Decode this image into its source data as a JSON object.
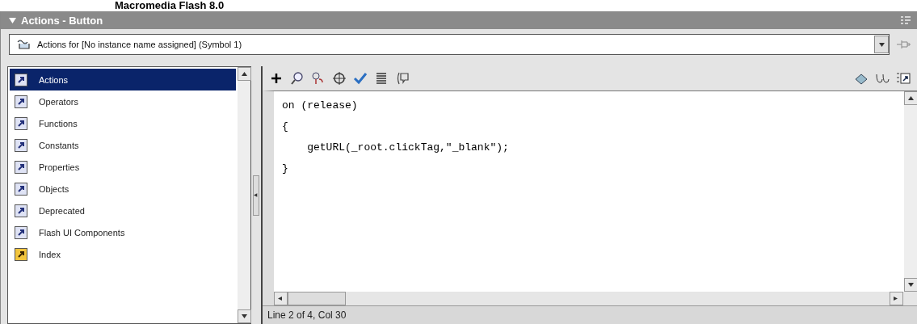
{
  "caption": "Macromedia Flash 8.0",
  "panel": {
    "title": "Actions - Button",
    "expanded": true
  },
  "target": {
    "value": "Actions for [No instance name assigned] (Symbol 1)"
  },
  "toolbox": {
    "items": [
      {
        "label": "Actions",
        "selected": true,
        "kind": "book"
      },
      {
        "label": "Operators",
        "selected": false,
        "kind": "book"
      },
      {
        "label": "Functions",
        "selected": false,
        "kind": "book"
      },
      {
        "label": "Constants",
        "selected": false,
        "kind": "book"
      },
      {
        "label": "Properties",
        "selected": false,
        "kind": "book"
      },
      {
        "label": "Objects",
        "selected": false,
        "kind": "book"
      },
      {
        "label": "Deprecated",
        "selected": false,
        "kind": "book"
      },
      {
        "label": "Flash UI Components",
        "selected": false,
        "kind": "book"
      },
      {
        "label": "Index",
        "selected": false,
        "kind": "index"
      }
    ]
  },
  "editor": {
    "lines": [
      "on (release)",
      "{",
      "    getURL(_root.clickTag,\"_blank\");",
      "}"
    ]
  },
  "status_bar": "Line 2 of 4, Col 30"
}
